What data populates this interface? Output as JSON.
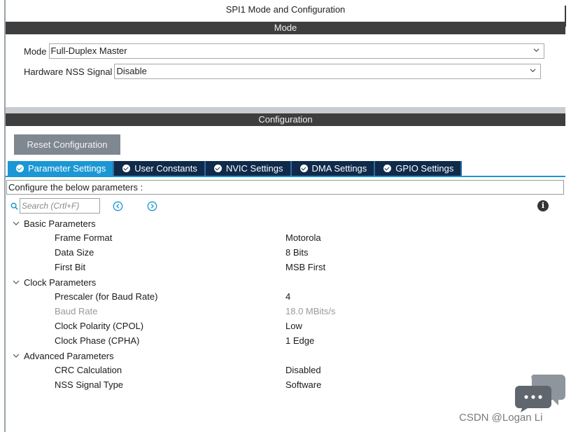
{
  "window_title": "SPI1 Mode and Configuration",
  "mode_section": {
    "header": "Mode",
    "mode_label": "Mode",
    "mode_value": "Full-Duplex Master",
    "nss_label": "Hardware NSS Signal",
    "nss_value": "Disable"
  },
  "config_section": {
    "header": "Configuration",
    "reset_button": "Reset Configuration",
    "tabs": [
      {
        "label": "Parameter Settings",
        "active": true
      },
      {
        "label": "User Constants",
        "active": false
      },
      {
        "label": "NVIC Settings",
        "active": false
      },
      {
        "label": "DMA Settings",
        "active": false
      },
      {
        "label": "GPIO Settings",
        "active": false
      }
    ],
    "configure_text": "Configure the below parameters :",
    "search_placeholder": "Search (Crtl+F)"
  },
  "parameters": {
    "basic": {
      "title": "Basic Parameters",
      "items": [
        {
          "name": "Frame Format",
          "value": "Motorola"
        },
        {
          "name": "Data Size",
          "value": "8 Bits"
        },
        {
          "name": "First Bit",
          "value": "MSB First"
        }
      ]
    },
    "clock": {
      "title": "Clock Parameters",
      "items": [
        {
          "name": "Prescaler (for Baud Rate)",
          "value": "4"
        },
        {
          "name": "Baud Rate",
          "value": "18.0 MBits/s",
          "disabled": true
        },
        {
          "name": "Clock Polarity (CPOL)",
          "value": "Low"
        },
        {
          "name": "Clock Phase (CPHA)",
          "value": "1 Edge"
        }
      ]
    },
    "advanced": {
      "title": "Advanced Parameters",
      "items": [
        {
          "name": "CRC Calculation",
          "value": "Disabled"
        },
        {
          "name": "NSS Signal Type",
          "value": "Software"
        }
      ]
    }
  },
  "watermark": "CSDN @Logan Li",
  "colors": {
    "accent": "#1a97d4",
    "tab_dark": "#0f2a4a",
    "section_bar": "#3e3e3e",
    "reset_button": "#7f8791"
  }
}
